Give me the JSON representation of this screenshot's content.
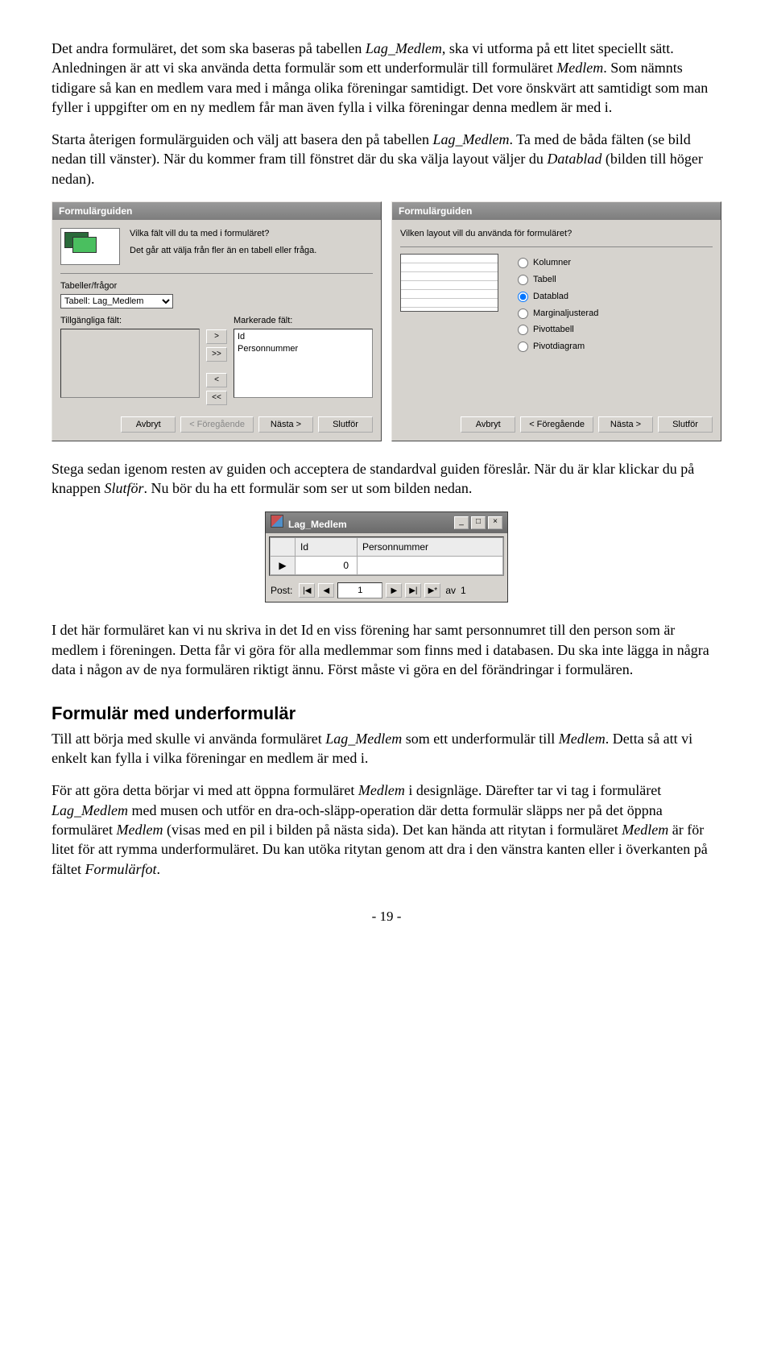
{
  "para1_a": "Det andra formuläret, det som ska baseras på tabellen ",
  "para1_it1": "Lag_Medlem",
  "para1_b": ", ska vi utforma på ett litet speciellt sätt. Anledningen är att vi ska använda detta formulär som ett underformulär till formuläret ",
  "para1_it2": "Medlem",
  "para1_c": ". Som nämnts tidigare så kan en medlem vara med i många olika föreningar samtidigt. Det vore önskvärt att samtidigt som man fyller i uppgifter om en ny medlem får man även fylla i vilka föreningar denna medlem är med i.",
  "para2_a": "Starta återigen formulärguiden och välj att basera den på tabellen ",
  "para2_it1": "Lag_Medlem",
  "para2_b": ". Ta med de båda fälten (se bild nedan till vänster). När du kommer fram till fönstret där du ska välja layout väljer du ",
  "para2_it2": "Datablad",
  "para2_c": " (bilden till höger nedan).",
  "wiz_title": "Formulärguiden",
  "wiz1": {
    "q1": "Vilka fält vill du ta med i formuläret?",
    "q2": "Det går att välja från fler än en tabell eller fråga.",
    "tables_label": "Tabeller/frågor",
    "combo_value": "Tabell: Lag_Medlem",
    "available_label": "Tillgängliga fält:",
    "selected_label": "Markerade fält:",
    "selected_items": [
      "Id",
      "Personnummer"
    ],
    "btn_r": ">",
    "btn_rr": ">>",
    "btn_l": "<",
    "btn_ll": "<<"
  },
  "wiz2": {
    "q1": "Vilken layout vill du använda för formuläret?",
    "radios": [
      "Kolumner",
      "Tabell",
      "Datablad",
      "Marginaljusterad",
      "Pivottabell",
      "Pivotdiagram"
    ],
    "selected": "Datablad"
  },
  "wiz_buttons": {
    "cancel": "Avbryt",
    "back": "< Föregående",
    "next": "Nästa >",
    "finish": "Slutför"
  },
  "para3_a": "Stega sedan igenom resten av guiden och acceptera de standardval guiden föreslår. När du är klar klickar du på knappen ",
  "para3_it1": "Slutför",
  "para3_b": ". Nu bör du ha ett formulär som ser ut som bilden nedan.",
  "miniform": {
    "title": "Lag_Medlem",
    "col1": "Id",
    "col2": "Personnummer",
    "row_marker": "▶",
    "val": "0",
    "post_label": "Post:",
    "first": "|◀",
    "prev": "◀",
    "cur": "1",
    "next": "▶",
    "last": "▶|",
    "new": "▶*",
    "of_label": "av",
    "of_total": "1",
    "min": "_",
    "max": "□",
    "close": "×"
  },
  "para4": "I det här formuläret kan vi nu skriva in det Id en viss förening har samt personnumret till den person som är medlem i föreningen. Detta får vi göra för alla medlemmar som finns med i databasen. Du ska inte lägga in några data i någon av de nya formulären riktigt ännu. Först måste vi göra en del förändringar i formulären.",
  "h2": "Formulär med underformulär",
  "para5_a": "Till att börja med skulle vi använda formuläret ",
  "para5_it1": "Lag_Medlem",
  "para5_b": " som ett underformulär till ",
  "para5_it2": "Medlem",
  "para5_c": ". Detta så att vi enkelt kan fylla i vilka föreningar en medlem är med i.",
  "para6_a": "För att göra detta börjar vi med att öppna formuläret ",
  "para6_it1": "Medlem",
  "para6_b": " i designläge. Därefter tar vi tag i formuläret ",
  "para6_it2": "Lag_Medlem",
  "para6_c": " med musen och utför en dra-och-släpp-operation där detta formulär släpps ner på det öppna formuläret ",
  "para6_it3": "Medlem",
  "para6_d": " (visas med en pil i bilden på nästa sida). Det kan hända att ritytan i formuläret ",
  "para6_it4": "Medlem",
  "para6_e": " är för litet för att rymma underformuläret. Du kan utöka ritytan genom att dra i den vänstra kanten eller i överkanten på fältet ",
  "para6_it5": "Formulärfot",
  "para6_f": ".",
  "pagenum": "- 19 -"
}
